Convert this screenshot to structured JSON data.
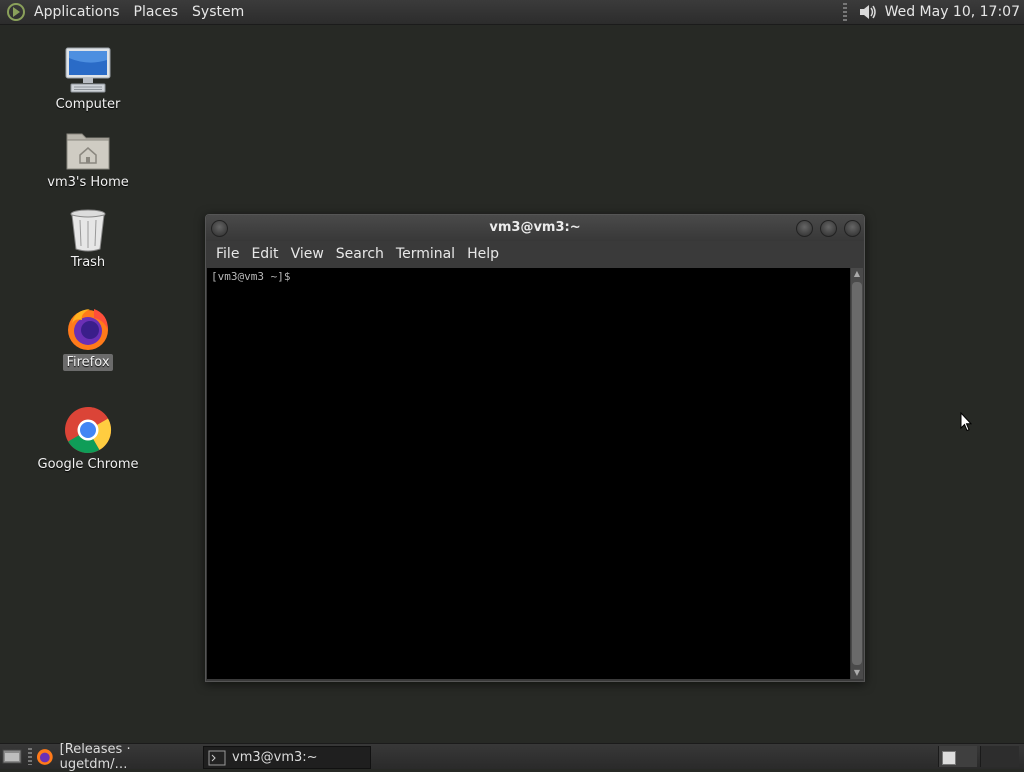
{
  "top_panel": {
    "menus": [
      "Applications",
      "Places",
      "System"
    ],
    "clock": "Wed May 10, 17:07"
  },
  "desktop": {
    "icons": [
      {
        "label": "Computer",
        "icon": "computer-icon"
      },
      {
        "label": "vm3's Home",
        "icon": "home-folder-icon"
      },
      {
        "label": "Trash",
        "icon": "trash-icon"
      },
      {
        "label": "Firefox",
        "icon": "firefox-icon",
        "selected": true
      },
      {
        "label": "Google Chrome",
        "icon": "chrome-icon"
      }
    ]
  },
  "terminal": {
    "title": "vm3@vm3:~",
    "menu": [
      "File",
      "Edit",
      "View",
      "Search",
      "Terminal",
      "Help"
    ],
    "prompt": "[vm3@vm3 ~]$"
  },
  "taskbar": {
    "tasks": [
      {
        "label": "[Releases · ugetdm/…",
        "icon": "firefox-icon",
        "active": false
      },
      {
        "label": "vm3@vm3:~",
        "icon": "terminal-icon",
        "active": true
      }
    ]
  }
}
